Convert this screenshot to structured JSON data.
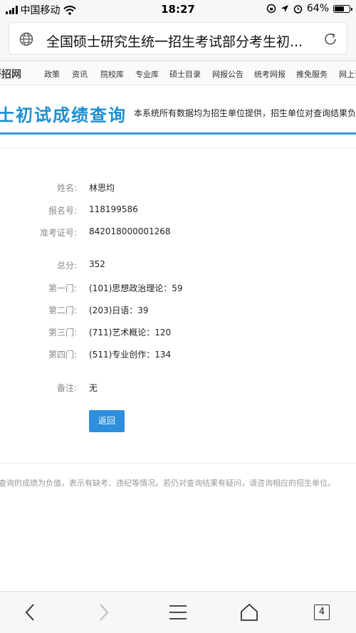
{
  "status_bar": {
    "carrier": "中国移动",
    "time": "18:27",
    "battery": "64%",
    "battery_level": 0.64
  },
  "browser": {
    "address_title": "全国硕士研究生统一招生考试部分考生初...",
    "tab_count": "4"
  },
  "nav": {
    "logo": "研招网",
    "items": [
      "政策",
      "资讯",
      "院校库",
      "专业库",
      "硕士目录",
      "网报公告",
      "统考网报",
      "推免服务",
      "网上调"
    ]
  },
  "page": {
    "heading": "士初试成绩查询",
    "description": "本系统所有数据均为招生单位提供，招生单位对查询结果负责",
    "rows": [
      {
        "label": "姓名:",
        "value": "林思均"
      },
      {
        "label": "报名号:",
        "value": "118199586"
      },
      {
        "label": "准考证号:",
        "value": "842018000001268"
      },
      {
        "label": "总分:",
        "value": "352"
      },
      {
        "label": "第一门:",
        "value": "(101)思想政治理论：59"
      },
      {
        "label": "第二门:",
        "value": "(203)日语：39"
      },
      {
        "label": "第三门:",
        "value": "(711)艺术概论：120"
      },
      {
        "label": "第四门:",
        "value": "(511)专业创作：134"
      },
      {
        "label": "备注:",
        "value": "无"
      }
    ],
    "back_button": "返回",
    "footnote": "查询的成绩为负值，表示有缺考、违纪等情况。若仍对查询结果有疑问，请咨询相应的招生单位。"
  }
}
